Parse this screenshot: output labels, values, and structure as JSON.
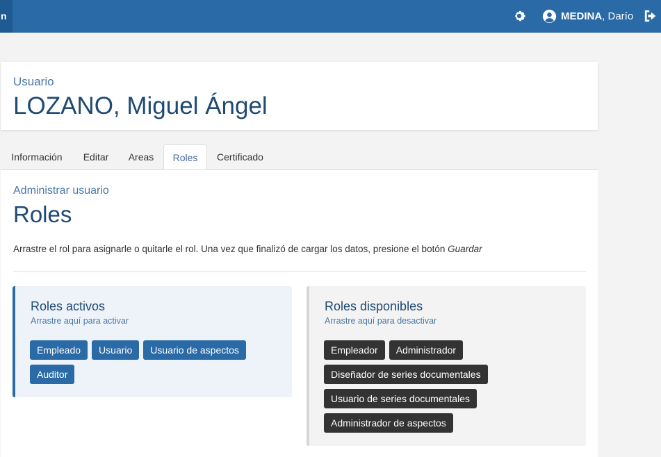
{
  "topbar": {
    "app_tab_label": "n",
    "user_lastname": "MEDINA",
    "user_firstname": ", Darío",
    "icons": {
      "settings": "gear-icon",
      "user": "user-circle-icon",
      "logout": "sign-out-icon"
    },
    "colors": {
      "bar": "#2a6aa6",
      "bar_dark": "#1f5a92"
    }
  },
  "header": {
    "kicker": "Usuario",
    "name": "LOZANO, Miguel Ángel"
  },
  "tabs": [
    {
      "label": "Información"
    },
    {
      "label": "Editar"
    },
    {
      "label": "Areas"
    },
    {
      "label": "Roles",
      "active": true
    },
    {
      "label": "Certificado"
    }
  ],
  "panel": {
    "kicker": "Administrar usuario",
    "title": "Roles",
    "help_text": "Arrastre el rol para asignarle o quitarle el rol. Una vez que finalizó de cargar los datos, presione el botón ",
    "help_emphasis": "Guardar"
  },
  "active_roles": {
    "title": "Roles activos",
    "subtitle": "Arrastre aquí para activar",
    "items": [
      "Empleado",
      "Usuario",
      "Usuario de aspectos",
      "Auditor"
    ],
    "color": "#2a6aa6"
  },
  "available_roles": {
    "title": "Roles disponibles",
    "subtitle": "Arrastre aquí para desactivar",
    "items": [
      "Empleador",
      "Administrador",
      "Diseñador de series documentales",
      "Usuario de series documentales",
      "Administrador de aspectos"
    ],
    "color": "#333333"
  }
}
